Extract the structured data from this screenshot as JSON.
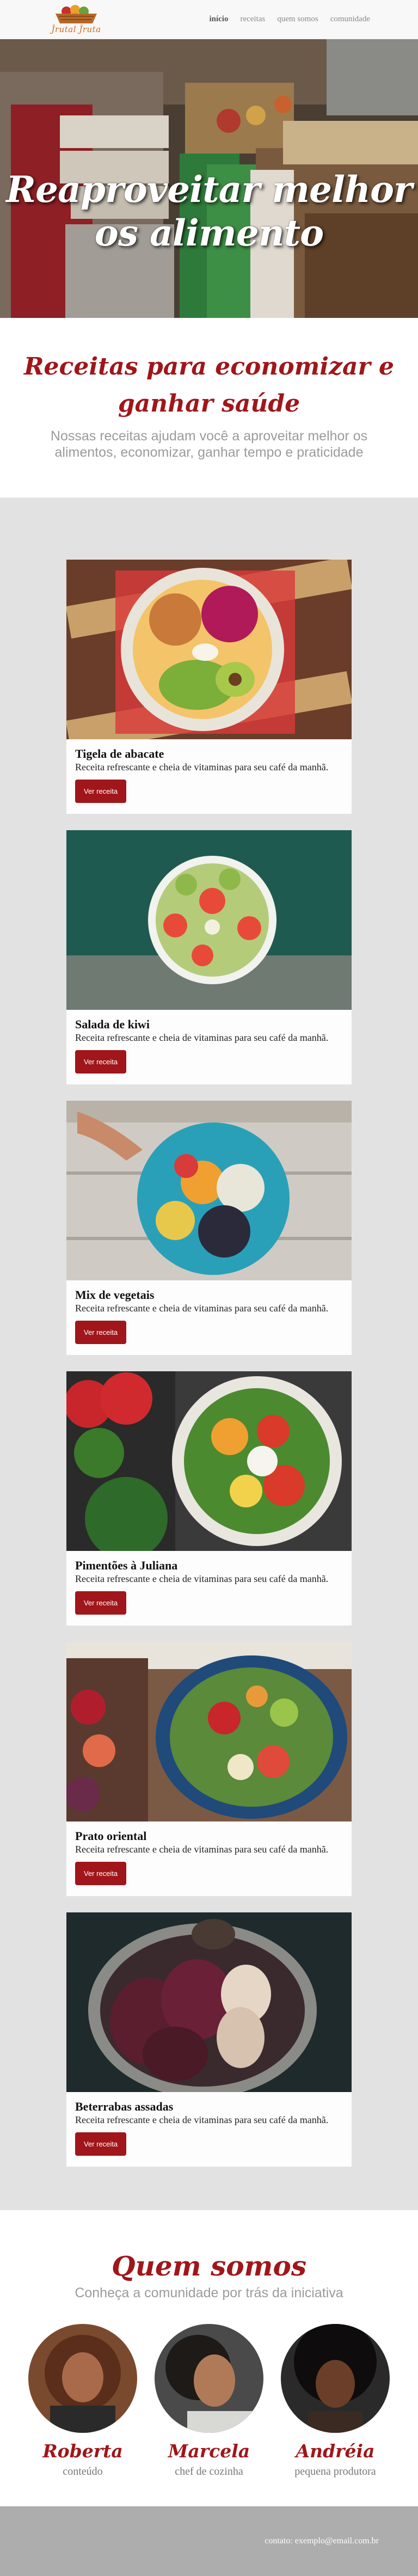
{
  "brand": {
    "logo_text": "Ĵrutal Ĵruta"
  },
  "nav": {
    "items": [
      {
        "label": "início",
        "active": true
      },
      {
        "label": "receitas",
        "active": false
      },
      {
        "label": "quem somos",
        "active": false
      },
      {
        "label": "comunidade",
        "active": false
      }
    ]
  },
  "hero": {
    "title": "Reaproveitar melhor os alimento"
  },
  "intro": {
    "title": "Receitas para economizar e ganhar saúde",
    "subtitle": "Nossas receitas ajudam você a aproveitar melhor os alimentos, economizar, ganhar tempo e praticidade"
  },
  "recipes": [
    {
      "title": "Tigela de abacate",
      "text": "Receita refrescante e cheia de vitaminas para seu café da manhã.",
      "button": "Ver receita",
      "image": "avocado-bowl"
    },
    {
      "title": "Salada de kiwi",
      "text": "Receita refrescante e cheia de vitaminas para seu café da manhã.",
      "button": "Ver receita",
      "image": "kiwi-bowl"
    },
    {
      "title": "Mix de vegetais",
      "text": "Receita refrescante e cheia de vitaminas para seu café da manhã.",
      "button": "Ver receita",
      "image": "vegetable-mix"
    },
    {
      "title": "Pimentões à Juliana",
      "text": "Receita refrescante e cheia de vitaminas para seu café da manhã.",
      "button": "Ver receita",
      "image": "peppers-plate"
    },
    {
      "title": "Prato oriental",
      "text": "Receita refrescante e cheia de vitaminas para seu café da manhã.",
      "button": "Ver receita",
      "image": "oriental-salad"
    },
    {
      "title": "Beterrabas assadas",
      "text": "Receita refrescante e cheia de vitaminas para seu café da manhã.",
      "button": "Ver receita",
      "image": "roasted-beets"
    }
  ],
  "about": {
    "title": "Quem somos",
    "subtitle": "Conheça a comunidade por trás da iniciativa",
    "members": [
      {
        "name": "Roberta",
        "role": "conteúdo"
      },
      {
        "name": "Marcela",
        "role": "chef de cozinha"
      },
      {
        "name": "Andréia",
        "role": "pequena produtora"
      }
    ]
  },
  "footer": {
    "contact": "contato: exemplo@email.com.br"
  },
  "colors": {
    "accent": "#a0161a",
    "muted_text": "#9b9b9b",
    "section_bg": "#e2e2e2",
    "footer_bg": "#adadad"
  }
}
